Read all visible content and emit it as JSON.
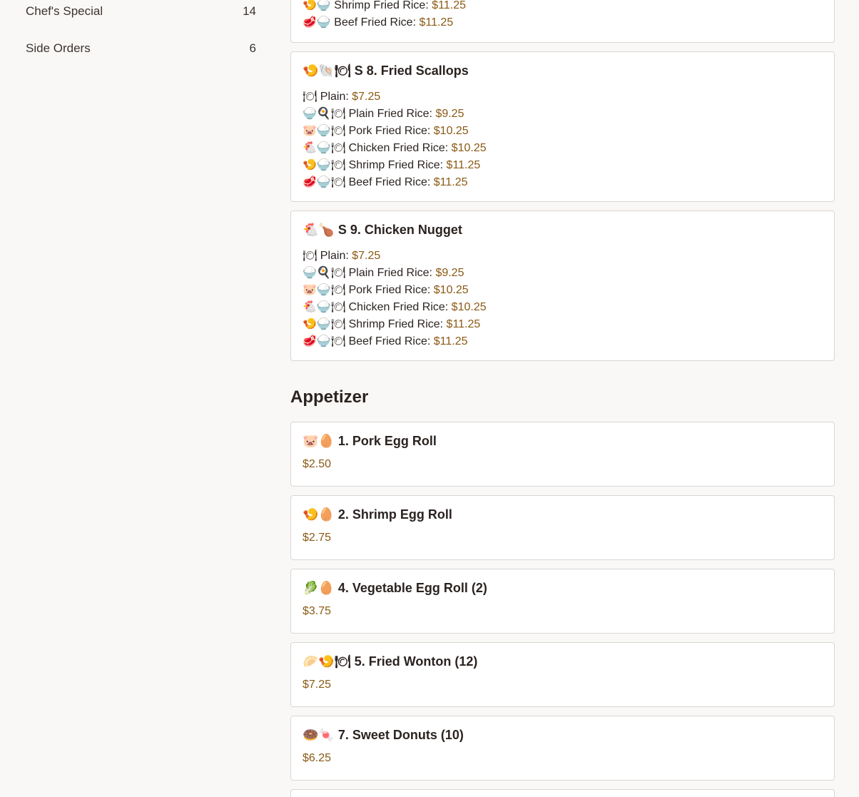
{
  "sidebar": {
    "categories": [
      {
        "label": "Chef's Special",
        "count": "14"
      },
      {
        "label": "Side Orders",
        "count": "6"
      }
    ]
  },
  "partial_card": {
    "options": [
      {
        "icon": "🍤🍚",
        "label": "Shrimp Fried Rice:",
        "price": "$11.25"
      },
      {
        "icon": "🥩🍚",
        "label": "Beef Fried Rice:",
        "price": "$11.25"
      }
    ]
  },
  "items": [
    {
      "icon": "🍤🐚🍽",
      "title": "S 8. Fried Scallops",
      "options": [
        {
          "icon": "🍽",
          "label": "Plain:",
          "price": "$7.25"
        },
        {
          "icon": "🍚🍳🍽",
          "label": "Plain Fried Rice:",
          "price": "$9.25"
        },
        {
          "icon": "🐷🍚🍽",
          "label": "Pork Fried Rice:",
          "price": "$10.25"
        },
        {
          "icon": "🐔🍚🍽",
          "label": "Chicken Fried Rice:",
          "price": "$10.25"
        },
        {
          "icon": "🍤🍚🍽",
          "label": "Shrimp Fried Rice:",
          "price": "$11.25"
        },
        {
          "icon": "🥩🍚🍽",
          "label": "Beef Fried Rice:",
          "price": "$11.25"
        }
      ]
    },
    {
      "icon": "🐔🍗",
      "title": "S 9. Chicken Nugget",
      "options": [
        {
          "icon": "🍽",
          "label": "Plain:",
          "price": "$7.25"
        },
        {
          "icon": "🍚🍳🍽",
          "label": "Plain Fried Rice:",
          "price": "$9.25"
        },
        {
          "icon": "🐷🍚🍽",
          "label": "Pork Fried Rice:",
          "price": "$10.25"
        },
        {
          "icon": "🐔🍚🍽",
          "label": "Chicken Fried Rice:",
          "price": "$10.25"
        },
        {
          "icon": "🍤🍚🍽",
          "label": "Shrimp Fried Rice:",
          "price": "$11.25"
        },
        {
          "icon": "🥩🍚🍽",
          "label": "Beef Fried Rice:",
          "price": "$11.25"
        }
      ]
    }
  ],
  "appetizer": {
    "section_title": "Appetizer",
    "items": [
      {
        "icon": "🐷🥚",
        "title": "1. Pork Egg Roll",
        "price": "$2.50"
      },
      {
        "icon": "🍤🥚",
        "title": "2. Shrimp Egg Roll",
        "price": "$2.75"
      },
      {
        "icon": "🥬🥚",
        "title": "4. Vegetable Egg Roll (2)",
        "price": "$3.75"
      },
      {
        "icon": "🥟🍤🍽",
        "title": "5. Fried Wonton (12)",
        "price": "$7.25"
      },
      {
        "icon": "🍩🍬",
        "title": "7. Sweet Donuts (10)",
        "price": "$6.25"
      }
    ]
  },
  "colors": {
    "background": "#faf8f6",
    "card_border": "#d9d6d3",
    "price": "#8a5a14",
    "text": "#2b2320"
  }
}
